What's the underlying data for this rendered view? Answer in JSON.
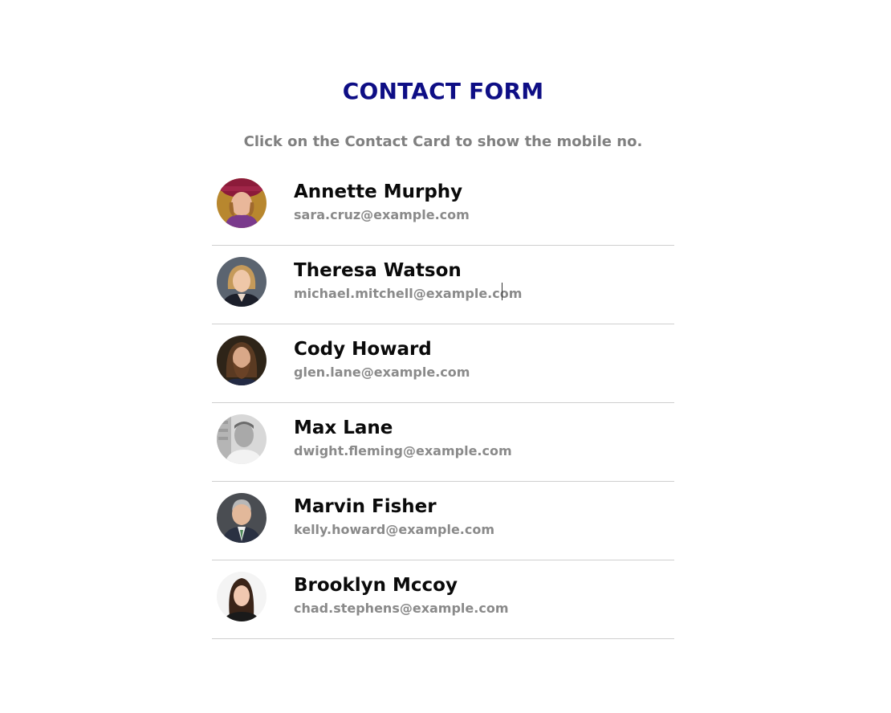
{
  "header": {
    "title": "CONTACT FORM",
    "subtitle": "Click on the Contact Card to show the mobile no."
  },
  "contacts": [
    {
      "name": "Annette Murphy",
      "email": "sara.cruz@example.com",
      "avatar_icon": "person-photo-icon"
    },
    {
      "name": "Theresa Watson",
      "email": "michael.mitchell@example.com",
      "avatar_icon": "person-photo-icon"
    },
    {
      "name": "Cody Howard",
      "email": "glen.lane@example.com",
      "avatar_icon": "person-photo-icon"
    },
    {
      "name": "Max Lane",
      "email": "dwight.fleming@example.com",
      "avatar_icon": "person-photo-icon"
    },
    {
      "name": "Marvin Fisher",
      "email": "kelly.howard@example.com",
      "avatar_icon": "person-photo-icon"
    },
    {
      "name": "Brooklyn Mccoy",
      "email": "chad.stephens@example.com",
      "avatar_icon": "person-photo-icon"
    }
  ],
  "colors": {
    "title": "#0e0e85",
    "subtitle": "#808080",
    "name": "#0a0a0a",
    "email": "#8a8a8a",
    "divider": "#cfcfcf"
  }
}
